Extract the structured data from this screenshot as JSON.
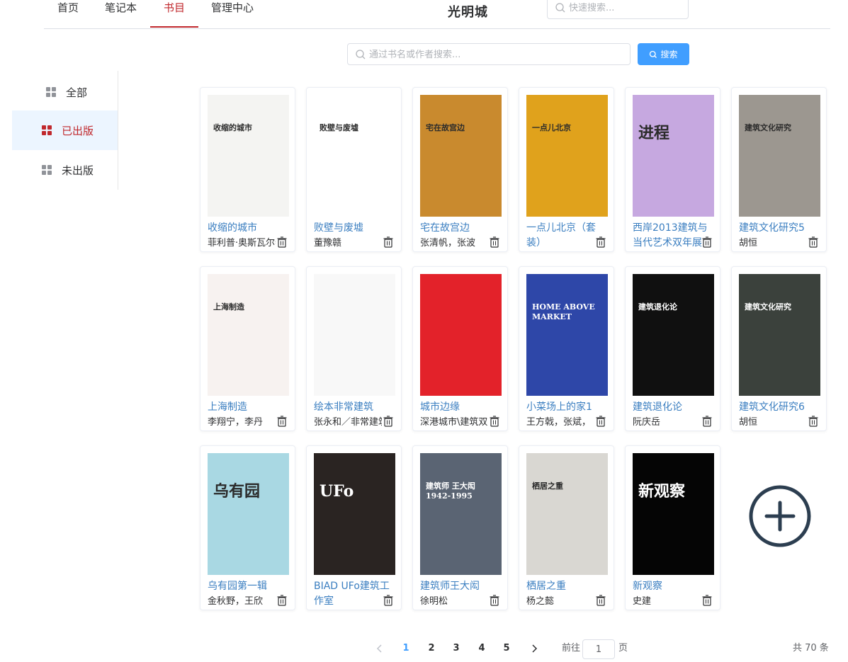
{
  "nav": {
    "items": [
      {
        "label": "首页",
        "active": false
      },
      {
        "label": "笔记本",
        "active": false
      },
      {
        "label": "书目",
        "active": true
      },
      {
        "label": "管理中心",
        "active": false
      }
    ],
    "brand": "光明城",
    "quick_search_placeholder": "快速搜索..."
  },
  "book_search": {
    "placeholder": "通过书名或作者搜索...",
    "button_label": "搜索"
  },
  "side_menu": [
    {
      "label": "全部",
      "active": false
    },
    {
      "label": "已出版",
      "active": true
    },
    {
      "label": "未出版",
      "active": false
    }
  ],
  "colors": {
    "accent_red": "#c0282d",
    "primary_blue": "#409eff",
    "title_blue": "#3a7ec0"
  },
  "books": [
    {
      "title": "收缩的城市",
      "author": "菲利普·奥斯瓦尔特",
      "cover_color": "#f4f4f2",
      "cover_text": "收缩的城市"
    },
    {
      "title": "败壁与废墟",
      "author": "董豫赣",
      "cover_color": "#ffffff",
      "cover_text": "败壁与废墟"
    },
    {
      "title": "宅在故宫边",
      "author": "张清帆，张波",
      "cover_color": "#c98a2e",
      "cover_text": "宅在故宫边"
    },
    {
      "title": "一点儿北京（套装）",
      "author": "",
      "cover_color": "#e0a21c",
      "cover_text": "一点儿北京"
    },
    {
      "title": "西岸2013建筑与当代艺术双年展",
      "author": "",
      "cover_color": "#c6a8e0",
      "cover_text": "进程"
    },
    {
      "title": "建筑文化研究5",
      "author": "胡恒",
      "cover_color": "#9c9790",
      "cover_text": "建筑文化研究"
    },
    {
      "title": "上海制造",
      "author": "李翔宁，李丹",
      "cover_color": "#f7f2f0",
      "cover_text": "上海制造"
    },
    {
      "title": "绘本非常建筑",
      "author": "张永和／非常建筑",
      "cover_color": "#f8f8f8",
      "cover_text": ""
    },
    {
      "title": "城市边缘",
      "author": "深港城市\\建筑双年展",
      "cover_color": "#e3222a",
      "cover_text": ""
    },
    {
      "title": "小菜场上的家1",
      "author": "王方戟，张斌，",
      "cover_color": "#2e47a8",
      "cover_text": "HOME ABOVE MARKET"
    },
    {
      "title": "建筑退化论",
      "author": "阮庆岳",
      "cover_color": "#101010",
      "cover_text": "建筑退化论"
    },
    {
      "title": "建筑文化研究6",
      "author": "胡恒",
      "cover_color": "#3b413c",
      "cover_text": "建筑文化研究"
    },
    {
      "title": "乌有园第一辑",
      "author": "金秋野，王欣",
      "cover_color": "#a9d8e3",
      "cover_text": "乌有园"
    },
    {
      "title": "BIAD UFo建筑工作室",
      "author": "",
      "cover_color": "#2a2422",
      "cover_text": "UFo"
    },
    {
      "title": "建筑师王大闳",
      "author": "徐明松",
      "cover_color": "#5a6473",
      "cover_text": "建筑师 王大闳 1942-1995"
    },
    {
      "title": "栖居之重",
      "author": "杨之懿",
      "cover_color": "#d9d7d2",
      "cover_text": "栖居之重"
    },
    {
      "title": "新观察",
      "author": "史建",
      "cover_color": "#050505",
      "cover_text": "新观察"
    }
  ],
  "pagination": {
    "pages": [
      "1",
      "2",
      "3",
      "4",
      "5"
    ],
    "current": "1",
    "goto_prefix": "前往",
    "goto_value": "1",
    "goto_suffix": "页",
    "total": "共 70 条"
  }
}
